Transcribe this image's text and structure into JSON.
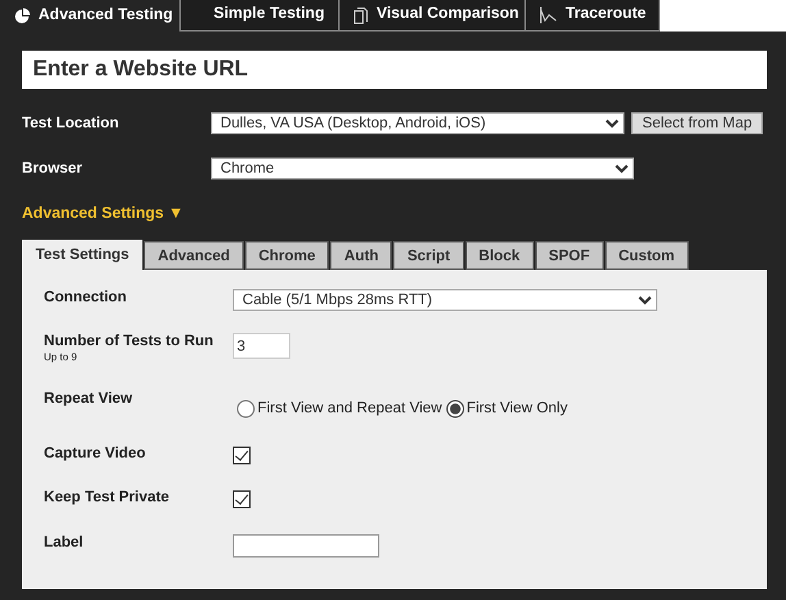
{
  "top_tabs": [
    {
      "label": "Advanced Testing",
      "selected": true
    },
    {
      "label": "Simple Testing",
      "selected": false
    },
    {
      "label": "Visual Comparison",
      "selected": false
    },
    {
      "label": "Traceroute",
      "selected": false
    }
  ],
  "url_field": {
    "placeholder": "Enter a Website URL"
  },
  "main_fields": [
    {
      "label": "Test Location",
      "value": "Dulles, VA USA (Desktop, Android, iOS)",
      "button": "Select from Map"
    },
    {
      "label": "Browser",
      "value": "Chrome"
    }
  ],
  "advanced_toggle": {
    "label": "Advanced Settings",
    "expanded": true,
    "arrow": "▼"
  },
  "sub_tabs": [
    {
      "label": "Test Settings",
      "selected": true
    },
    {
      "label": "Advanced",
      "selected": false
    },
    {
      "label": "Chrome",
      "selected": false
    },
    {
      "label": "Auth",
      "selected": false
    },
    {
      "label": "Script",
      "selected": false
    },
    {
      "label": "Block",
      "selected": false
    },
    {
      "label": "SPOF",
      "selected": false
    },
    {
      "label": "Custom",
      "selected": false
    }
  ],
  "settings": [
    {
      "kind": "select",
      "label": "Connection",
      "value": "Cable (5/1 Mbps 28ms RTT)"
    },
    {
      "kind": "number",
      "label": "Number of Tests to Run",
      "hint": "Up to 9",
      "value": "3"
    },
    {
      "kind": "radio",
      "label": "Repeat View",
      "options": [
        {
          "label": "First View and Repeat View",
          "selected": false
        },
        {
          "label": "First View Only",
          "selected": true
        }
      ]
    },
    {
      "kind": "checkbox",
      "label": "Capture Video",
      "checked": true
    },
    {
      "kind": "checkbox",
      "label": "Keep Test Private",
      "checked": true
    },
    {
      "kind": "text",
      "label": "Label"
    }
  ]
}
